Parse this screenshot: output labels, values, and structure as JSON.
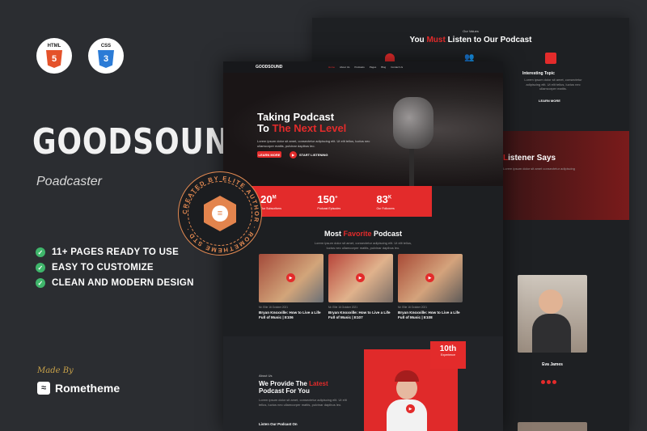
{
  "badges": [
    {
      "label": "HTML",
      "num": "5",
      "color": "#e4522a"
    },
    {
      "label": "CSS",
      "num": "3",
      "color": "#2b7bd6"
    }
  ],
  "brand": {
    "name": "GOODSOUND",
    "tagline": "Poadcaster"
  },
  "features": [
    "11+ PAGES READY TO USE",
    "EASY TO CUSTOMIZE",
    "CLEAN AND MODERN DESIGN"
  ],
  "made_by": {
    "label": "Made By",
    "company": "Rometheme"
  },
  "circle_badge": {
    "text": "CREATED BY ELITE AUTHOR · ROMETHEME STD ·"
  },
  "back_page": {
    "values_kicker": "Our Values",
    "values_title_a": "You ",
    "values_title_b": "Must",
    "values_title_c": " Listen to Our Podcast",
    "topic_title": "Interesting Topic",
    "topic_text": "Lorem ipsum dolor sit amet, consectetur adipiscing elit. Ut elit tellus, luctus nec ullamcorper mattis.",
    "topic_link": "LEARN MORE",
    "listener_title": "istener Says",
    "host_name": "Eva James"
  },
  "front_page": {
    "logo": "GOODSOUND",
    "nav": [
      "Home",
      "About Us",
      "Podcasts",
      "Pages",
      "Blog",
      "Contact Us"
    ],
    "hero_line1": "Taking Podcast",
    "hero_line2a": "To ",
    "hero_line2b": "The Next Level",
    "hero_text": "Lorem ipsum dolor sit amet, consectetur adipiscing elit. Ut elit tellus, luctus nec ullamcorper mattis, pulvinar dapibus leo.",
    "btn_learn": "LEARN MORE",
    "btn_listen": "START LISTENING",
    "stats": [
      {
        "num": "20",
        "sup": "M",
        "label": "Our Subscribers"
      },
      {
        "num": "150",
        "sup": "+",
        "label": "Podcast Episodes"
      },
      {
        "num": "83",
        "sup": "K",
        "label": "Our Followers"
      }
    ],
    "fav_title_a": "Most ",
    "fav_title_b": "Favorite",
    "fav_title_c": " Podcast",
    "fav_text": "Lorem ipsum dolor sit amet, consectetur adipiscing elit. Ut elit tellus, luctus nec ullamcorper mattis, pulvinar dapibus leo.",
    "episodes": [
      {
        "meta": "Mr. Ellie   16 October 2021",
        "title": "Bryan Knoxville: How to Live a Life Full of Music | E106"
      },
      {
        "meta": "Mr. Ellie   16 October 2021",
        "title": "Bryan Knoxville: How to Live a Life Full of Music | E107"
      },
      {
        "meta": "Mr. Ellie   16 October 2021",
        "title": "Bryan Knoxville: How to Live a Life Full of Music | E108"
      }
    ],
    "about_kicker": "About Us",
    "about_title_a": "We Provide The ",
    "about_title_b": "Latest",
    "about_title_c": "Podcast For You",
    "about_text": "Lorem ipsum dolor sit amet, consectetur adipiscing elit. Ut elit tellus, luctus nec ullamcorper mattis, pulvinar dapibus leo.",
    "listen_label": "Listen Our Podcast On",
    "experience_num": "10th",
    "experience_label": "Experience"
  }
}
